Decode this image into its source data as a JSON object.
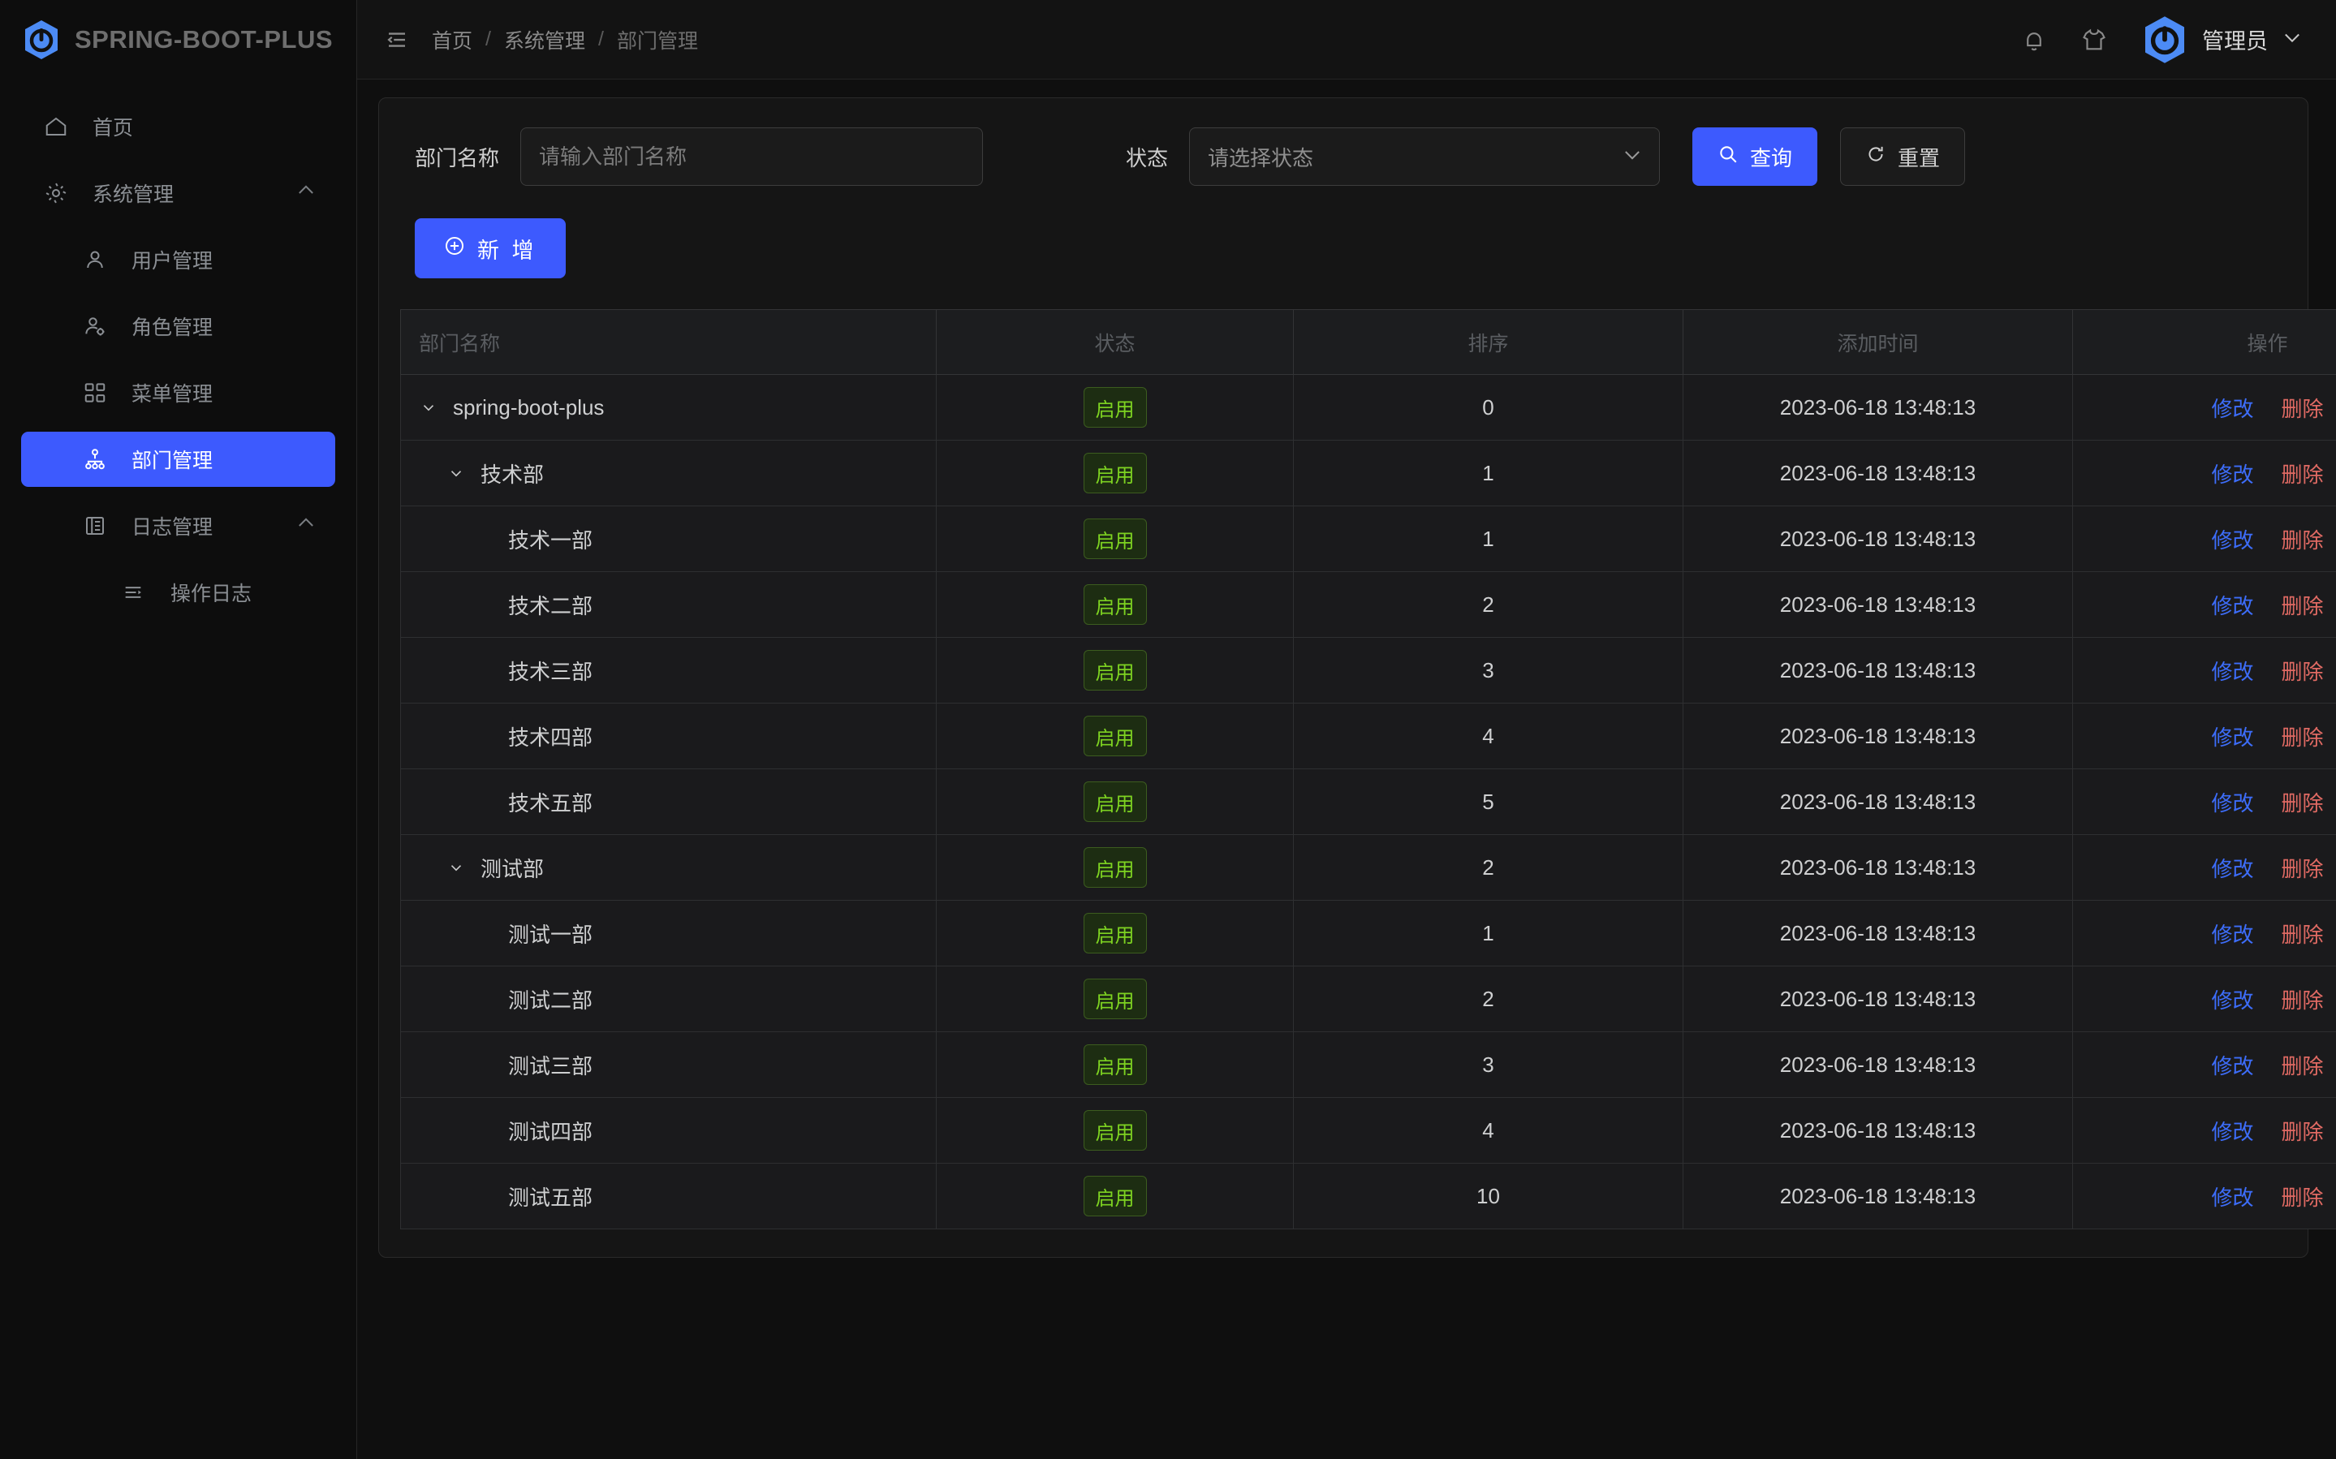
{
  "brand": {
    "name": "SPRING-BOOT-PLUS",
    "logo_icon": "spring-boot-power-icon"
  },
  "sidebar": {
    "items": [
      {
        "label": "首页",
        "icon": "home-icon",
        "level": 1,
        "active": false,
        "arrow": ""
      },
      {
        "label": "系统管理",
        "icon": "gear-icon",
        "level": 1,
        "active": false,
        "arrow": "chevron-up-icon"
      },
      {
        "label": "用户管理",
        "icon": "user-icon",
        "level": 2,
        "active": false,
        "arrow": ""
      },
      {
        "label": "角色管理",
        "icon": "user-gear-icon",
        "level": 2,
        "active": false,
        "arrow": ""
      },
      {
        "label": "菜单管理",
        "icon": "grid-icon",
        "level": 2,
        "active": false,
        "arrow": ""
      },
      {
        "label": "部门管理",
        "icon": "sitemap-icon",
        "level": 2,
        "active": true,
        "arrow": ""
      },
      {
        "label": "日志管理",
        "icon": "book-icon",
        "level": 2,
        "active": false,
        "arrow": "chevron-up-icon"
      },
      {
        "label": "操作日志",
        "icon": "list-icon",
        "level": 3,
        "active": false,
        "arrow": ""
      }
    ]
  },
  "topbar": {
    "collapse_icon": "menu-fold-icon",
    "breadcrumb": [
      "首页",
      "系统管理",
      "部门管理"
    ],
    "separator": "/",
    "bell_icon": "bell-icon",
    "theme_icon": "shirt-icon",
    "user_name": "管理员",
    "user_caret": "chevron-down-icon",
    "avatar_icon": "spring-boot-power-icon"
  },
  "search": {
    "name_label": "部门名称",
    "name_value": "",
    "name_placeholder": "请输入部门名称",
    "status_label": "状态",
    "status_value": "请选择状态",
    "status_caret": "chevron-down-icon",
    "query_label": "查询",
    "query_icon": "search-icon",
    "reset_label": "重置",
    "reset_icon": "refresh-icon"
  },
  "toolbar": {
    "add_label": "新 增",
    "add_icon": "plus-circle-icon"
  },
  "table": {
    "columns": [
      "部门名称",
      "状态",
      "排序",
      "添加时间",
      "操作"
    ],
    "ops": {
      "edit": "修改",
      "delete": "删除"
    },
    "rows": [
      {
        "name": "spring-boot-plus",
        "indent": 0,
        "expandable": true,
        "status": "启用",
        "sort": "0",
        "time": "2023-06-18 13:48:13"
      },
      {
        "name": "技术部",
        "indent": 1,
        "expandable": true,
        "status": "启用",
        "sort": "1",
        "time": "2023-06-18 13:48:13"
      },
      {
        "name": "技术一部",
        "indent": 2,
        "expandable": false,
        "status": "启用",
        "sort": "1",
        "time": "2023-06-18 13:48:13"
      },
      {
        "name": "技术二部",
        "indent": 2,
        "expandable": false,
        "status": "启用",
        "sort": "2",
        "time": "2023-06-18 13:48:13"
      },
      {
        "name": "技术三部",
        "indent": 2,
        "expandable": false,
        "status": "启用",
        "sort": "3",
        "time": "2023-06-18 13:48:13"
      },
      {
        "name": "技术四部",
        "indent": 2,
        "expandable": false,
        "status": "启用",
        "sort": "4",
        "time": "2023-06-18 13:48:13"
      },
      {
        "name": "技术五部",
        "indent": 2,
        "expandable": false,
        "status": "启用",
        "sort": "5",
        "time": "2023-06-18 13:48:13"
      },
      {
        "name": "测试部",
        "indent": 1,
        "expandable": true,
        "status": "启用",
        "sort": "2",
        "time": "2023-06-18 13:48:13"
      },
      {
        "name": "测试一部",
        "indent": 2,
        "expandable": false,
        "status": "启用",
        "sort": "1",
        "time": "2023-06-18 13:48:13"
      },
      {
        "name": "测试二部",
        "indent": 2,
        "expandable": false,
        "status": "启用",
        "sort": "2",
        "time": "2023-06-18 13:48:13"
      },
      {
        "name": "测试三部",
        "indent": 2,
        "expandable": false,
        "status": "启用",
        "sort": "3",
        "time": "2023-06-18 13:48:13"
      },
      {
        "name": "测试四部",
        "indent": 2,
        "expandable": false,
        "status": "启用",
        "sort": "4",
        "time": "2023-06-18 13:48:13"
      },
      {
        "name": "测试五部",
        "indent": 2,
        "expandable": false,
        "status": "启用",
        "sort": "10",
        "time": "2023-06-18 13:48:13"
      }
    ]
  },
  "colors": {
    "accent": "#3d5afe",
    "status_green": "#7ed321",
    "delete_red": "#e06a63",
    "edit_blue": "#3d6dfa",
    "page_bg": "#0f0f0f",
    "card_bg": "#151515"
  }
}
